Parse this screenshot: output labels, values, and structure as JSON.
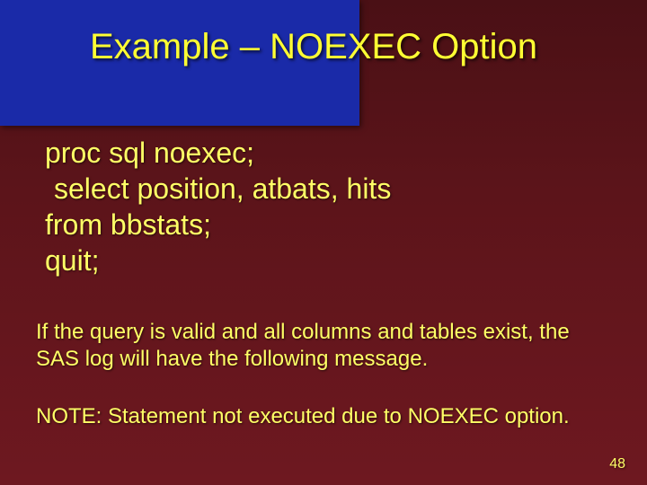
{
  "title": "Example – NOEXEC Option",
  "code": {
    "line1": "proc sql noexec;",
    "line2": "select position, atbats, hits",
    "line3": "from bbstats;",
    "line4": "quit;"
  },
  "note": "If the query is valid and all columns and tables exist, the SAS log will have the following message.",
  "log_note": "NOTE:  Statement not executed due to NOEXEC option.",
  "page_number": "48"
}
